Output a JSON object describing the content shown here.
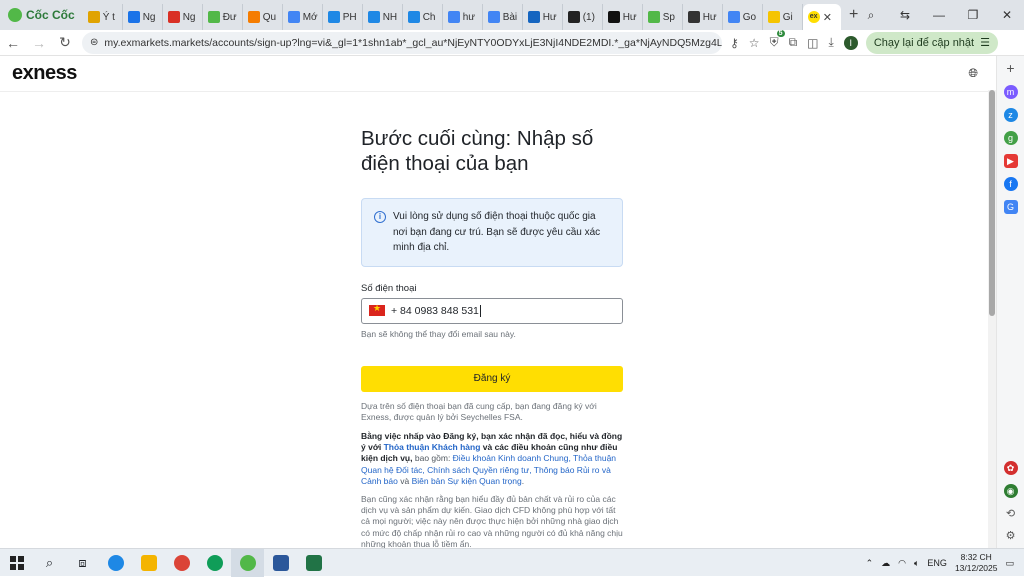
{
  "browser": {
    "brand": "Cốc Cốc",
    "tabs": [
      {
        "label": "Ý t",
        "color": "#e0a300"
      },
      {
        "label": "Ng",
        "color": "#1a73e8"
      },
      {
        "label": "Ng",
        "color": "#d93025"
      },
      {
        "label": "Đư",
        "color": "#52b848"
      },
      {
        "label": "Qu",
        "color": "#f57c00"
      },
      {
        "label": "Mớ",
        "color": "#4285f4"
      },
      {
        "label": "PH",
        "color": "#1e88e5"
      },
      {
        "label": "NH",
        "color": "#1e88e5"
      },
      {
        "label": "Ch",
        "color": "#1e88e5"
      },
      {
        "label": "hư",
        "color": "#4285f4"
      },
      {
        "label": "Bài",
        "color": "#4285f4"
      },
      {
        "label": "Hư",
        "color": "#1565c0"
      },
      {
        "label": "(1)",
        "color": "#222222"
      },
      {
        "label": "Hư",
        "color": "#111111"
      },
      {
        "label": "Sp",
        "color": "#52b848"
      },
      {
        "label": "Hư",
        "color": "#333333"
      },
      {
        "label": "Go",
        "color": "#4285f4"
      },
      {
        "label": "Gi",
        "color": "#f5c400"
      }
    ],
    "active_tab": {
      "label": "ex",
      "color": "#ffde02"
    },
    "url": "my.exmarkets.markets/accounts/sign-up?lng=vi&_gl=1*1shn1ab*_gcl_au*NjEyNTY0ODYxLjE3NjI4NDE2MDI.*_ga*NjAyNDQ5Mzg4LjE3NjI4NDE2M...",
    "extension_badge": "5",
    "profile_initial": "I",
    "update_button": "Chạy lại để cập nhật"
  },
  "site": {
    "logo": "exness",
    "title": "Bước cuối cùng: Nhập số điện thoại của bạn",
    "notice": "Vui lòng sử dụng số điện thoại thuộc quốc gia nơi bạn đang cư trú. Bạn sẽ được yêu cầu xác minh địa chỉ.",
    "phone_label": "Số điện thoại",
    "phone_value": "+ 84 0983 848 531",
    "phone_hint": "Bạn sẽ không thể thay đổi email sau này.",
    "submit_label": "Đăng ký",
    "para1": "Dựa trên số điện thoại bạn đã cung cấp, bạn đang đăng ký với Exness, được quản lý bởi Seychelles FSA.",
    "para2_a": "Bằng việc nhấp vào Đăng ký, bạn xác nhận đã đọc, hiểu và đồng ý với ",
    "para2_link1": "Thỏa thuận Khách hàng",
    "para2_b": " và các điều khoản cũng như điều kiện dịch vụ,",
    "para2_c": " bao gồm: ",
    "para2_link2": "Điều khoản Kinh doanh Chung, Thỏa thuận Quan hệ Đối tác, Chính sách Quyền riêng tư, Thông báo Rủi ro và Cảnh báo",
    "para2_d": " và ",
    "para2_link3": "Biên bản Sự kiện Quan trọng",
    "para2_e": ".",
    "para3": "Bạn cũng xác nhận rằng bạn hiểu đầy đủ bản chất và rủi ro của các dịch vụ và sản phẩm dự kiến. Giao dịch CFD không phù hợp với tất cả mọi người; việc này nên được thực hiện bởi những nhà giao dịch có mức độ chấp nhận rủi ro cao và những người có đủ khả năng chịu những khoản thua lỗ tiềm ẩn."
  },
  "taskbar": {
    "lang": "ENG",
    "time": "8:32 CH",
    "date": "13/12/2025"
  }
}
